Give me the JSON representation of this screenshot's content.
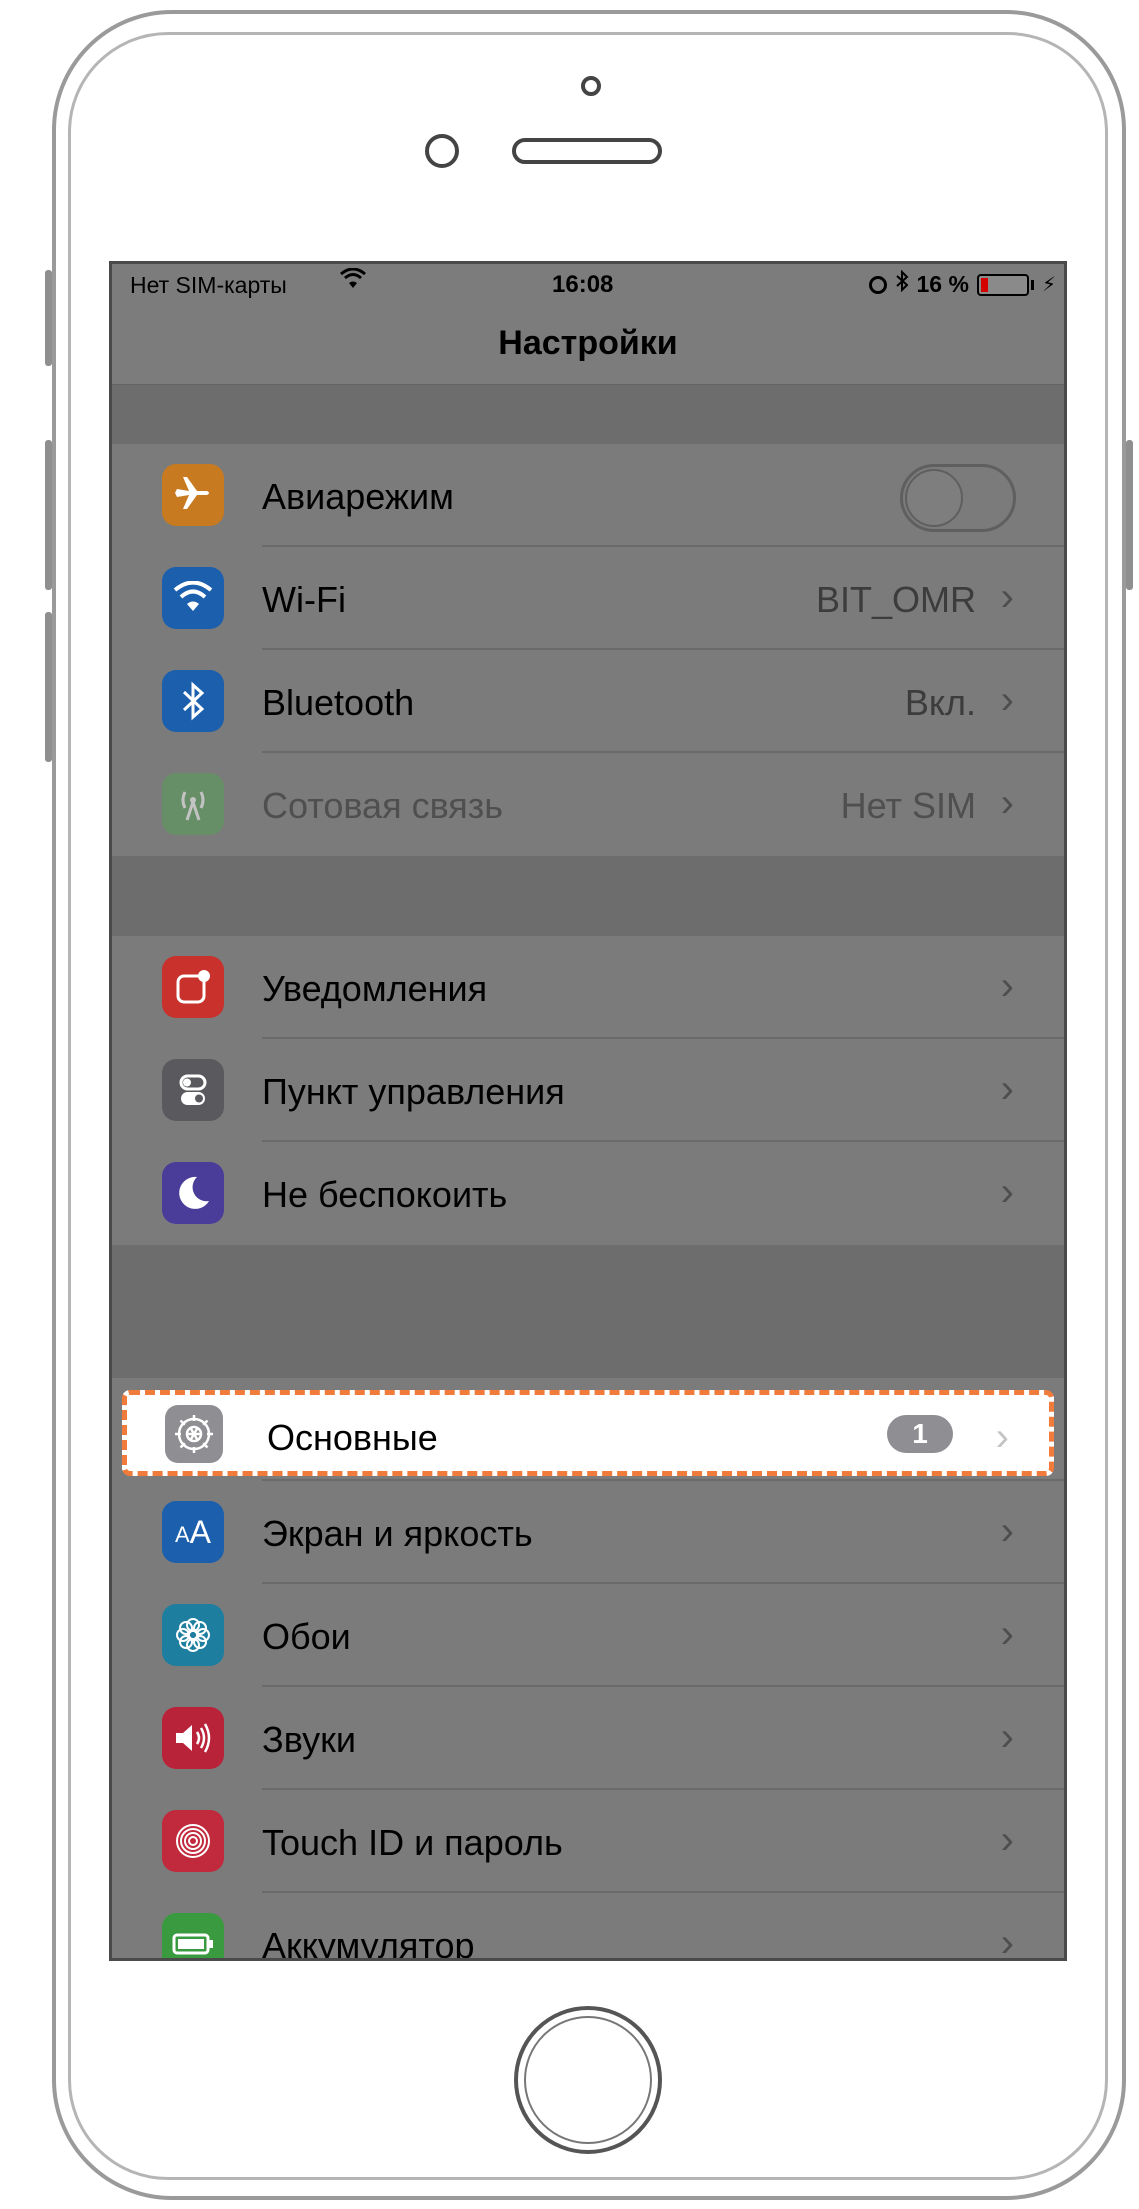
{
  "status_bar": {
    "carrier": "Нет SIM-карты",
    "wifi_icon": "wifi-icon",
    "time": "16:08",
    "bluetooth_icon": "bluetooth-icon",
    "battery_percent": "16 %",
    "battery_level": 0.16,
    "charging_icon": "⚡"
  },
  "nav": {
    "title": "Настройки"
  },
  "groups": {
    "connectivity": [
      {
        "label": "Авиарежим",
        "icon": "airplane-icon",
        "color": "#c77a1f",
        "toggle": false
      },
      {
        "label": "Wi-Fi",
        "value": "BIT_OMR",
        "icon": "wifi-icon",
        "color": "#1b5fad"
      },
      {
        "label": "Bluetooth",
        "value": "Вкл.",
        "icon": "bluetooth-icon",
        "color": "#1b5fad"
      },
      {
        "label": "Сотовая связь",
        "value": "Нет SIM",
        "icon": "antenna-icon",
        "color": "#55a05a",
        "disabled": true
      }
    ],
    "notifications": [
      {
        "label": "Уведомления",
        "icon": "notifications-icon",
        "color": "#c9312c"
      },
      {
        "label": "Пункт управления",
        "icon": "control-center-icon",
        "color": "#5a5a5e"
      },
      {
        "label": "Не беспокоить",
        "icon": "moon-icon",
        "color": "#4a3d9a"
      }
    ],
    "general": [
      {
        "label": "Основные",
        "icon": "gear-icon",
        "color": "#8e8e93",
        "badge": "1",
        "highlighted": true
      },
      {
        "label": "Экран и яркость",
        "icon": "display-brightness-icon",
        "color": "#1b5fad"
      },
      {
        "label": "Обои",
        "icon": "wallpaper-icon",
        "color": "#1d7ea0"
      },
      {
        "label": "Звуки",
        "icon": "speaker-icon",
        "color": "#b8233a"
      },
      {
        "label": "Touch ID и пароль",
        "icon": "fingerprint-icon",
        "color": "#c02a3c"
      },
      {
        "label": "Аккумулятор",
        "icon": "battery-icon",
        "color": "#3a9a3f"
      }
    ]
  },
  "highlight_color": "#f07b3a"
}
